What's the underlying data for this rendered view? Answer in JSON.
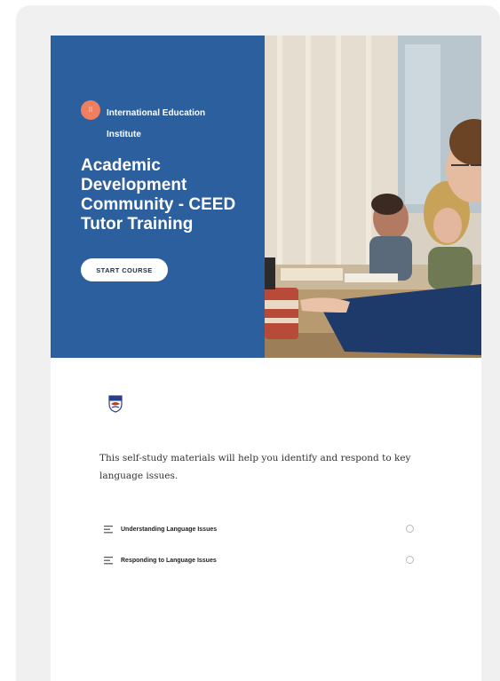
{
  "hero": {
    "org_badge": "II",
    "org_name": "International Education Institute",
    "course_title": "Academic Development Community - CEED Tutor Training",
    "start_button": "START COURSE"
  },
  "logo_icon": "crest-icon",
  "intro_text": "This self-study materials will help you identify and respond to key language issues.",
  "lessons": [
    {
      "label": "Understanding Language Issues",
      "icon": "lesson-lines-icon",
      "status_icon": "incomplete-circle-icon"
    },
    {
      "label": "Responding to Language Issues",
      "icon": "lesson-lines-icon",
      "status_icon": "incomplete-circle-icon"
    }
  ],
  "colors": {
    "hero_blue": "#2c5f9e",
    "badge_coral": "#f07f5f",
    "frame_gray": "#f0f0f0"
  }
}
